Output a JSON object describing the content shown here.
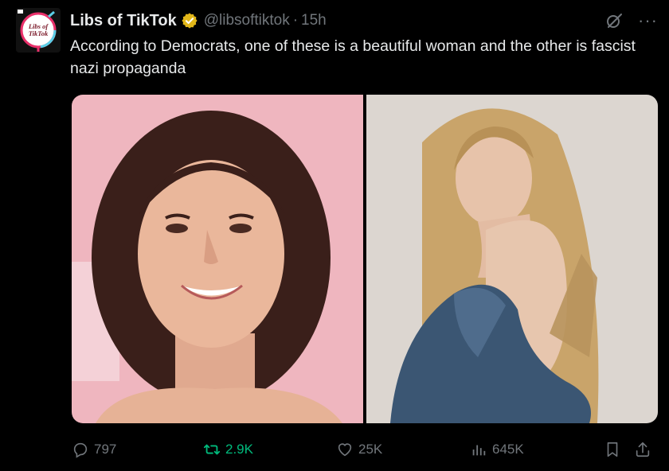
{
  "tweet": {
    "author_name": "Libs of TikTok",
    "handle": "@libsoftiktok",
    "separator": "·",
    "time": "15h",
    "text": "According to Democrats, one of these is a beautiful woman and the other is fascist nazi propaganda",
    "avatar_text_line1": "Libs of",
    "avatar_text_line2": "TikTok"
  },
  "metrics": {
    "replies": "797",
    "retweets": "2.9K",
    "likes": "25K",
    "views": "645K"
  },
  "header": {
    "more_label": "···"
  },
  "colors": {
    "background": "#000000",
    "text": "#e7e9ea",
    "muted": "#71767b",
    "retweet_green": "#00ba7c",
    "verified_gold": "#e2b719"
  },
  "icons": {
    "badge": "verified-gold-badge",
    "grok": "grok-icon",
    "more": "more-icon",
    "reply": "reply-icon",
    "retweet": "retweet-icon",
    "like": "heart-icon",
    "views": "views-icon",
    "bookmark": "bookmark-icon",
    "share": "share-icon"
  }
}
